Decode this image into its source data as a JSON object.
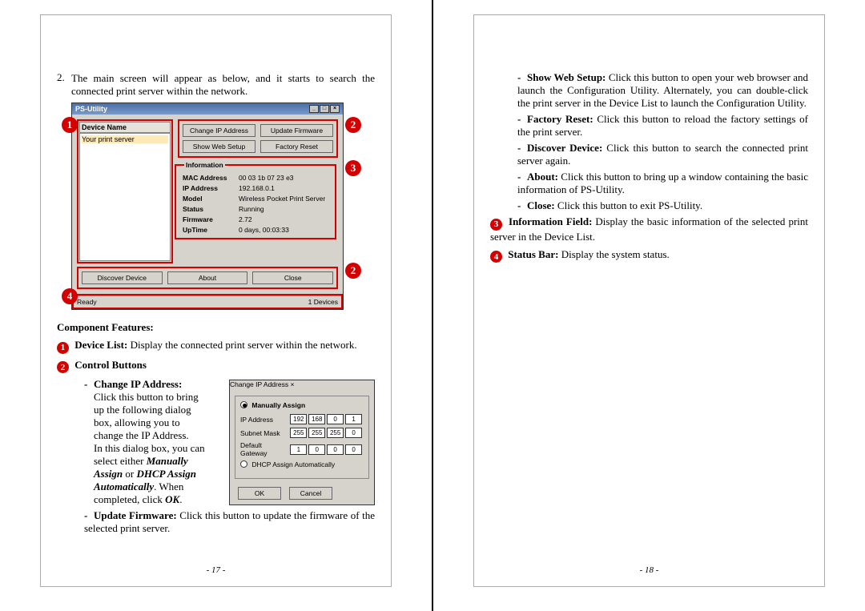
{
  "left": {
    "step_num": "2.",
    "step_text": "The main screen will appear as below, and it starts to search the connected print server within the network.",
    "psu": {
      "title": "PS-Utility",
      "dev_head": "Device Name",
      "dev_row": "Your print server",
      "btn_change_ip": "Change IP Address",
      "btn_update_fw": "Update Firmware",
      "btn_show_web": "Show Web Setup",
      "btn_factory": "Factory Reset",
      "info_legend": "Information",
      "info": {
        "mac_l": "MAC Address",
        "mac_v": "00 03 1b 07 23 e3",
        "ip_l": "IP Address",
        "ip_v": "192.168.0.1",
        "model_l": "Model",
        "model_v": "Wireless Pocket Print Server",
        "status_l": "Status",
        "status_v": "Running",
        "fw_l": "Firmware",
        "fw_v": "2.72",
        "up_l": "UpTime",
        "up_v": "0 days, 00:03:33"
      },
      "btn_discover": "Discover Device",
      "btn_about": "About",
      "btn_close": "Close",
      "status_l": "Ready",
      "status_r": "1 Devices"
    },
    "callouts": {
      "c1": "1",
      "c2a": "2",
      "c2b": "2",
      "c3": "3",
      "c4": "4"
    },
    "features_head": "Component Features:",
    "feat1_text": "Display the connected print server within the network.",
    "feat1_label": "Device List:",
    "feat2_head": "Control Buttons",
    "chip_head": "Change IP Address:",
    "chip_l1": "Click this button to bring",
    "chip_l2": "up the following dialog",
    "chip_l3": "box, allowing you to",
    "chip_l4": "change the IP Address.",
    "chip_l5": "In this dialog box, you can",
    "chip_l6a": "select either ",
    "chip_l6b": "Manually",
    "chip_l7a": "Assign",
    "chip_l7b": " or ",
    "chip_l7c": "DHCP Assign",
    "chip_l8a": "Automatically",
    "chip_l8b": ".   When",
    "chip_l9a": "completed, click ",
    "chip_l9b": "OK",
    "chip_l9c": ".",
    "upfw_head": "Update Firmware:",
    "upfw_text": " Click this button to update the firmware of the selected print server.",
    "ipdlg": {
      "title": "Change IP Address",
      "r_manual": "Manually Assign",
      "l_ip": "IP Address",
      "ip": [
        "192",
        "168",
        "0",
        "1"
      ],
      "l_sm": "Subnet Mask",
      "sm": [
        "255",
        "255",
        "255",
        "0"
      ],
      "l_gw": "Default Gateway",
      "gw": [
        "1",
        "0",
        "0",
        "0"
      ],
      "r_dhcp": "DHCP Assign Automatically",
      "ok": "OK",
      "cancel": "Cancel"
    },
    "pagenum": "- 17 -"
  },
  "right": {
    "show_web_h": "Show Web Setup:",
    "show_web_t": " Click this button to open your web browser and launch the Configuration Utility.  Alternately, you can double-click the print server in the Device List to launch the Configuration Utility.",
    "factory_h": "Factory Reset:",
    "factory_t": " Click this button to reload the factory settings of the print server.",
    "discover_h": "Discover Device:",
    "discover_t": " Click this button to search the connected print server again.",
    "about_h": "About:",
    "about_t": " Click this button to bring up a window containing the basic information of PS-Utility.",
    "close_h": "Close:",
    "close_t": " Click this button to exit PS-Utility.",
    "info_h": "Information Field:",
    "info_t": " Display the basic information of the selected print server in the Device List.",
    "status_h": "Status Bar:",
    "status_t": " Display the system status.",
    "mnum3": "3",
    "mnum4": "4",
    "pagenum": "- 18 -"
  }
}
